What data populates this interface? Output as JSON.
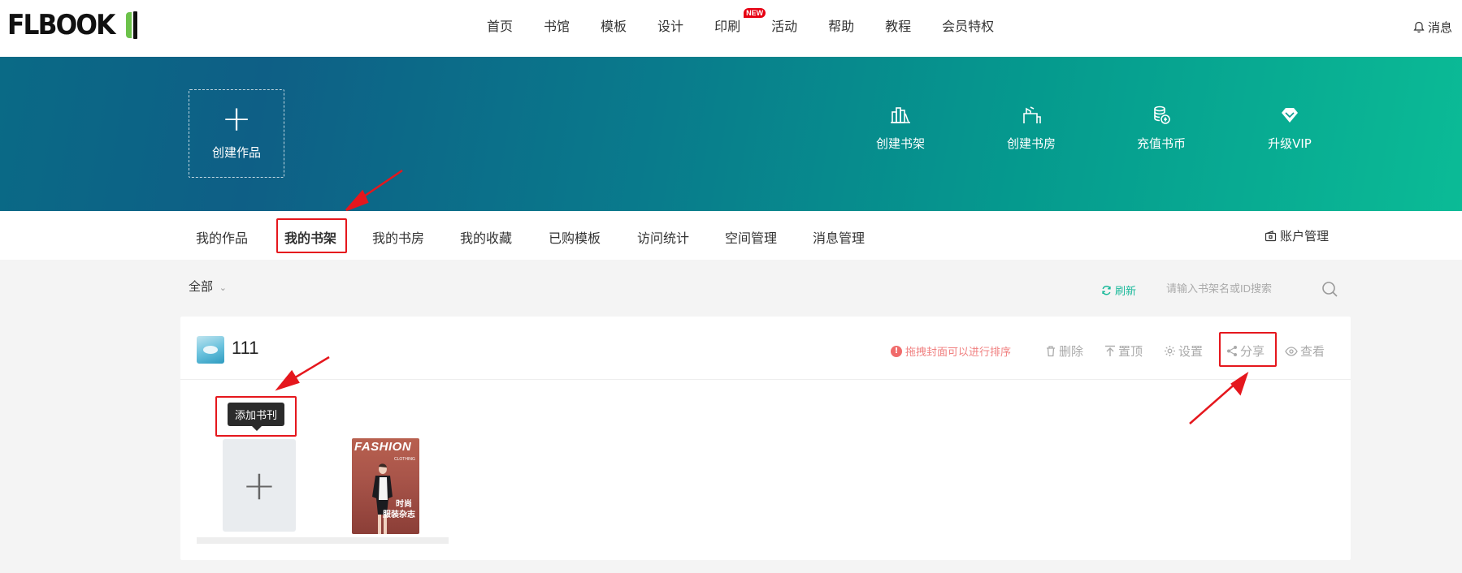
{
  "header": {
    "logo_text": "FLBOOK",
    "nav": [
      {
        "label": "首页"
      },
      {
        "label": "书馆"
      },
      {
        "label": "模板"
      },
      {
        "label": "设计"
      },
      {
        "label": "印刷",
        "badge": "NEW"
      },
      {
        "label": "活动"
      },
      {
        "label": "帮助"
      },
      {
        "label": "教程"
      },
      {
        "label": "会员特权"
      }
    ],
    "message_label": "消息"
  },
  "banner": {
    "create_work_label": "创建作品",
    "quick_actions": [
      {
        "label": "创建书架",
        "icon": "bookshelf-icon"
      },
      {
        "label": "创建书房",
        "icon": "study-room-icon"
      },
      {
        "label": "充值书币",
        "icon": "coins-icon"
      },
      {
        "label": "升级VIP",
        "icon": "diamond-icon"
      }
    ]
  },
  "subnav": {
    "tabs": [
      {
        "label": "我的作品"
      },
      {
        "label": "我的书架",
        "active": true
      },
      {
        "label": "我的书房"
      },
      {
        "label": "我的收藏"
      },
      {
        "label": "已购模板"
      },
      {
        "label": "访问统计"
      },
      {
        "label": "空间管理"
      },
      {
        "label": "消息管理"
      }
    ],
    "account_label": "账户管理"
  },
  "filter": {
    "selected": "全部",
    "refresh_label": "刷新",
    "search_placeholder": "请输入书架名或ID搜索"
  },
  "shelf": {
    "name": "111",
    "hint": "拖拽封面可以进行排序",
    "actions": {
      "delete": "删除",
      "top": "置顶",
      "settings": "设置",
      "share": "分享",
      "view": "查看"
    },
    "add_book_tooltip": "添加书刊",
    "books": [
      {
        "cover_title": "FASHION",
        "cover_subtitle": "CLOTHING",
        "cover_text_line1": "时尚",
        "cover_text_line2": "服装杂志"
      }
    ]
  },
  "colors": {
    "accent_green": "#1ab99a",
    "annotation_red": "#e5171d",
    "hint_red": "#f08080"
  }
}
